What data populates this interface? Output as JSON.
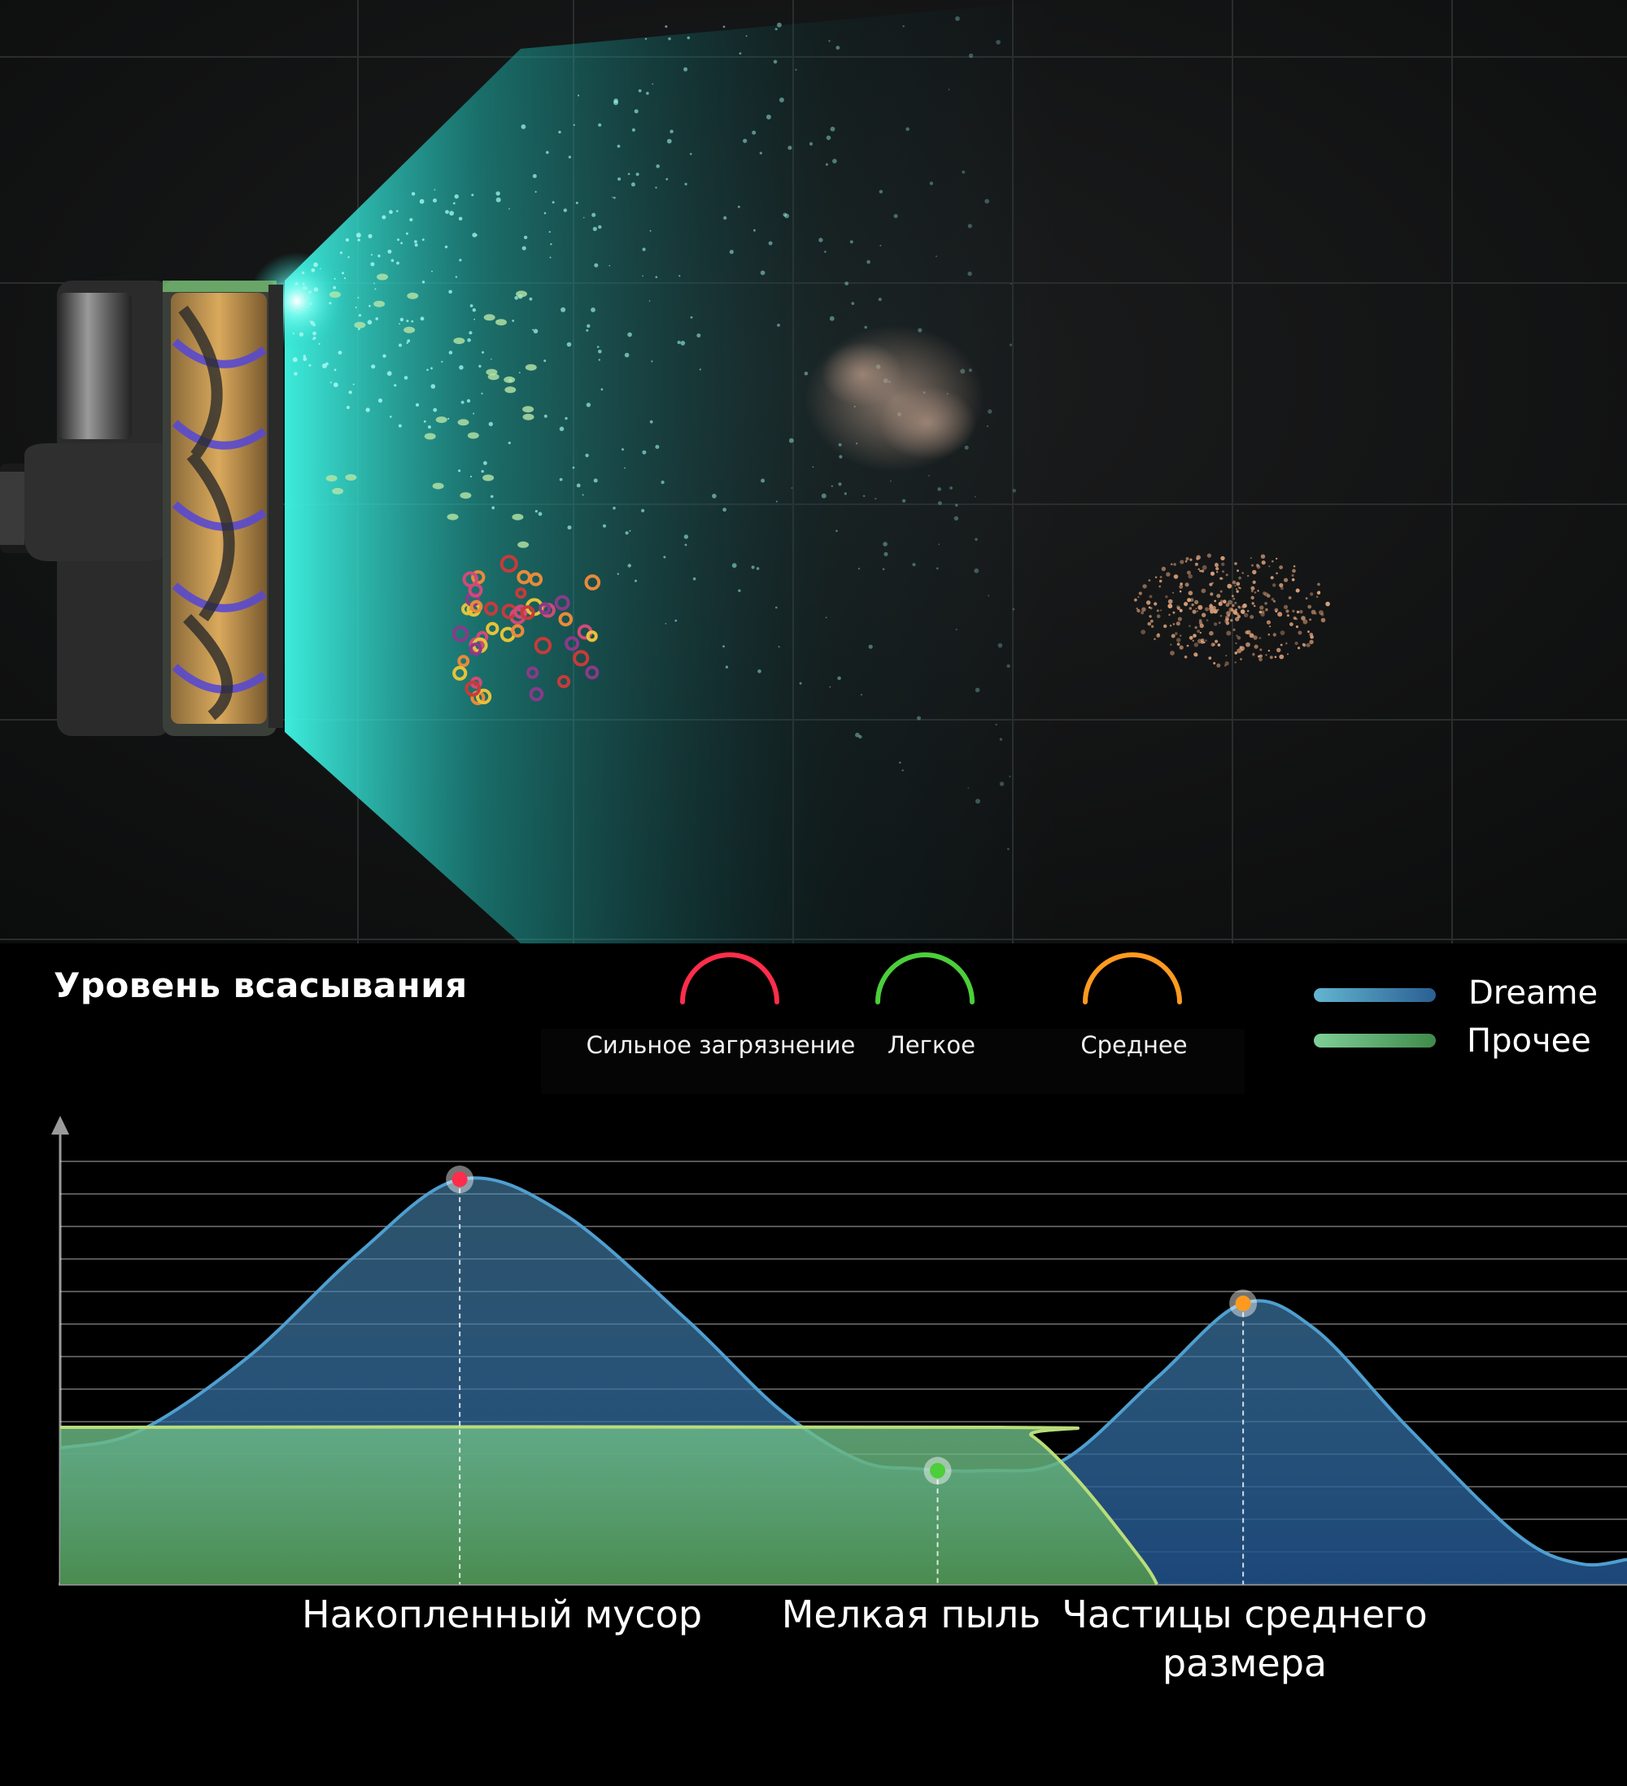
{
  "chart_data": {
    "type": "area",
    "title": "Уровень всасывания",
    "xlabel": "",
    "ylabel": "",
    "grid": true,
    "legend_placement": "top-right",
    "categories": [
      "Накопленный мусор",
      "Мелкая пыль",
      "Частицы среднего размера"
    ],
    "ylim": [
      0,
      100
    ],
    "series": [
      {
        "name": "Dreame",
        "color": "#3f8fc4",
        "points": [
          [
            0,
            33
          ],
          [
            0.05,
            37
          ],
          [
            0.12,
            55
          ],
          [
            0.19,
            80
          ],
          [
            0.255,
            98
          ],
          [
            0.32,
            90
          ],
          [
            0.4,
            64
          ],
          [
            0.46,
            42
          ],
          [
            0.51,
            30
          ],
          [
            0.545,
            28
          ],
          [
            0.59,
            27.5
          ],
          [
            0.64,
            30
          ],
          [
            0.7,
            50
          ],
          [
            0.755,
            68
          ],
          [
            0.8,
            62
          ],
          [
            0.86,
            38
          ],
          [
            0.93,
            12
          ],
          [
            0.97,
            5
          ],
          [
            1.0,
            6
          ]
        ]
      },
      {
        "name": "Прочее",
        "color": "#6fbf73",
        "points": [
          [
            0,
            38
          ],
          [
            0.6,
            38
          ],
          [
            0.62,
            36
          ],
          [
            0.65,
            25
          ],
          [
            0.69,
            6
          ],
          [
            0.7,
            0
          ]
        ]
      }
    ],
    "markers": [
      {
        "category": "Накопленный мусор",
        "x": 0.255,
        "y": 98,
        "color": "#ff2d4b"
      },
      {
        "category": "Мелкая пыль",
        "x": 0.56,
        "y": 27.5,
        "color": "#4ccf3a"
      },
      {
        "category": "Частицы среднего размера",
        "x": 0.755,
        "y": 68,
        "color": "#ff9a1f"
      }
    ]
  },
  "legend_arcs": [
    {
      "label": "Сильное загрязнение",
      "color": "#ff2d4b"
    },
    {
      "label": "Легкое",
      "color": "#4ccf3a"
    },
    {
      "label": "Среднее",
      "color": "#ff9a1f"
    }
  ],
  "series_legend": [
    {
      "label": "Dreame",
      "color": "#3f8fc4"
    },
    {
      "label": "Прочее",
      "color": "#6fbf73"
    }
  ]
}
